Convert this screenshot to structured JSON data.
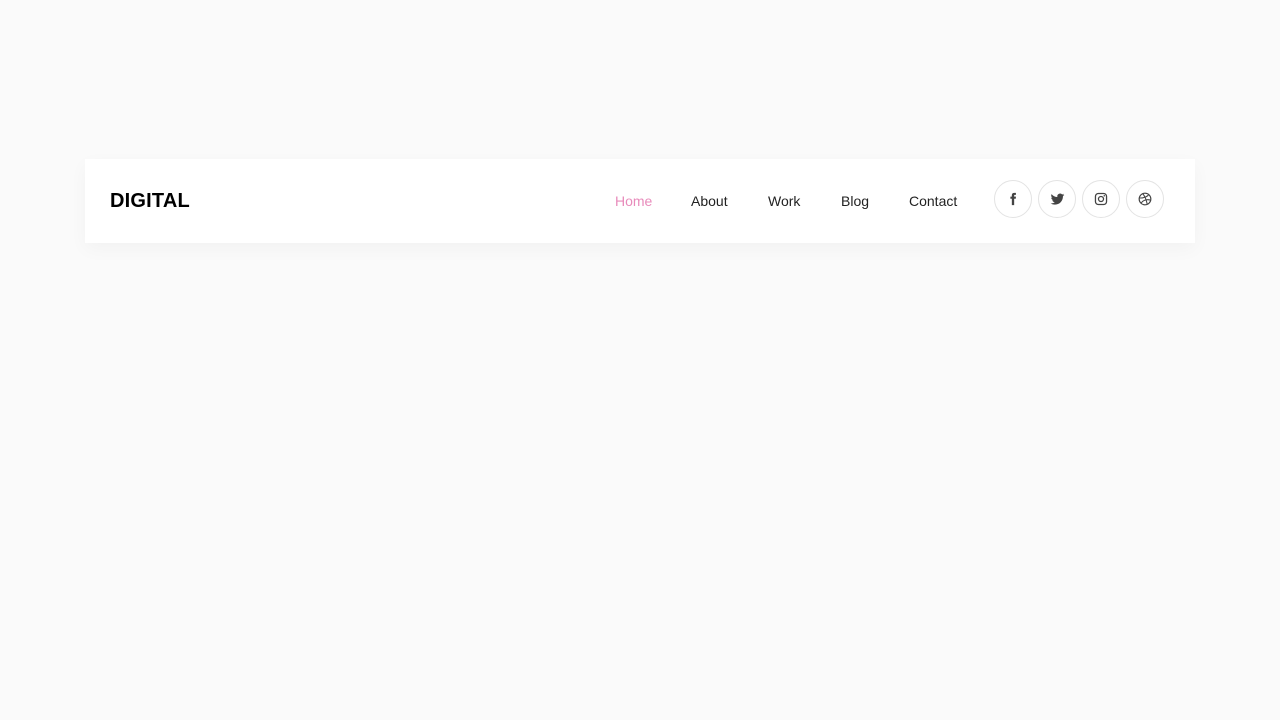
{
  "header": {
    "logo": "DIGITAL",
    "nav": [
      {
        "label": "Home",
        "active": true
      },
      {
        "label": "About",
        "active": false
      },
      {
        "label": "Work",
        "active": false
      },
      {
        "label": "Blog",
        "active": false
      },
      {
        "label": "Contact",
        "active": false
      }
    ],
    "social": [
      {
        "icon": "facebook-icon"
      },
      {
        "icon": "twitter-icon"
      },
      {
        "icon": "instagram-icon"
      },
      {
        "icon": "dribbble-icon"
      }
    ]
  },
  "colors": {
    "page_background": "#fafafa",
    "header_background": "#ffffff",
    "active_link": "#e88bbb",
    "link": "#222222",
    "icon": "#444444"
  }
}
